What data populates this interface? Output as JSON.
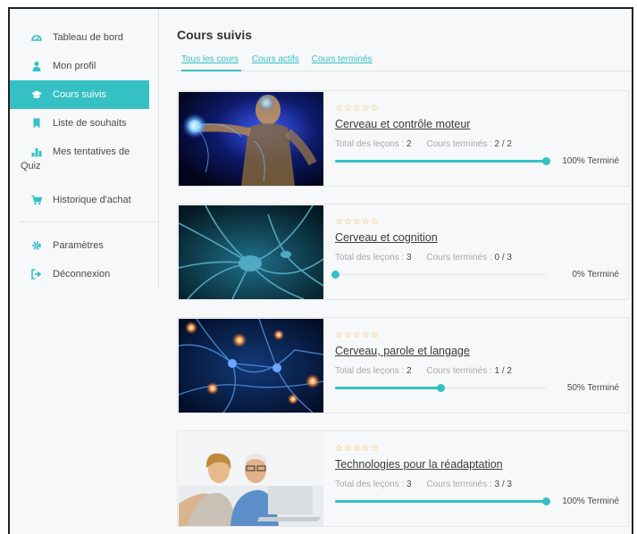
{
  "sidebar": {
    "items": [
      {
        "label": "Tableau de bord",
        "icon": "dashboard-icon"
      },
      {
        "label": "Mon profil",
        "icon": "user-icon"
      },
      {
        "label": "Cours suivis",
        "icon": "graduation-cap-icon",
        "active": true
      },
      {
        "label": "Liste de souhaits",
        "icon": "bookmark-icon"
      },
      {
        "label": "Mes tentatives de",
        "label2": "Quiz",
        "icon": "quiz-icon"
      },
      {
        "label": "Historique d'achat",
        "icon": "cart-icon"
      }
    ],
    "bottom_items": [
      {
        "label": "Paramètres",
        "icon": "gear-icon"
      },
      {
        "label": "Déconnexion",
        "icon": "logout-icon"
      }
    ]
  },
  "main": {
    "title": "Cours suivis",
    "tabs": [
      "Tous les cours",
      "Cours actifs",
      "Cours terminés"
    ],
    "active_tab": 0,
    "lessons_label": "Total des leçons :",
    "completed_label": "Cours terminés :",
    "courses": [
      {
        "title": "Cerveau et contrôle moteur",
        "stars": "☆☆☆☆☆",
        "lessons": "2",
        "completed": "2 / 2",
        "progress": 100,
        "progress_label": "100% Terminé"
      },
      {
        "title": "Cerveau et cognition",
        "stars": "☆☆☆☆☆",
        "lessons": "3",
        "completed": "0 / 3",
        "progress": 0,
        "progress_label": "0% Terminé"
      },
      {
        "title": "Cerveau, parole et langage",
        "stars": "☆☆☆☆☆",
        "lessons": "2",
        "completed": "1 / 2",
        "progress": 50,
        "progress_label": "50% Terminé"
      },
      {
        "title": "Technologies pour la réadaptation",
        "stars": "☆☆☆☆☆",
        "lessons": "3",
        "completed": "3 / 3",
        "progress": 100,
        "progress_label": "100% Terminé"
      }
    ]
  },
  "colors": {
    "accent": "#35c0c4",
    "star": "#f2b92e"
  }
}
